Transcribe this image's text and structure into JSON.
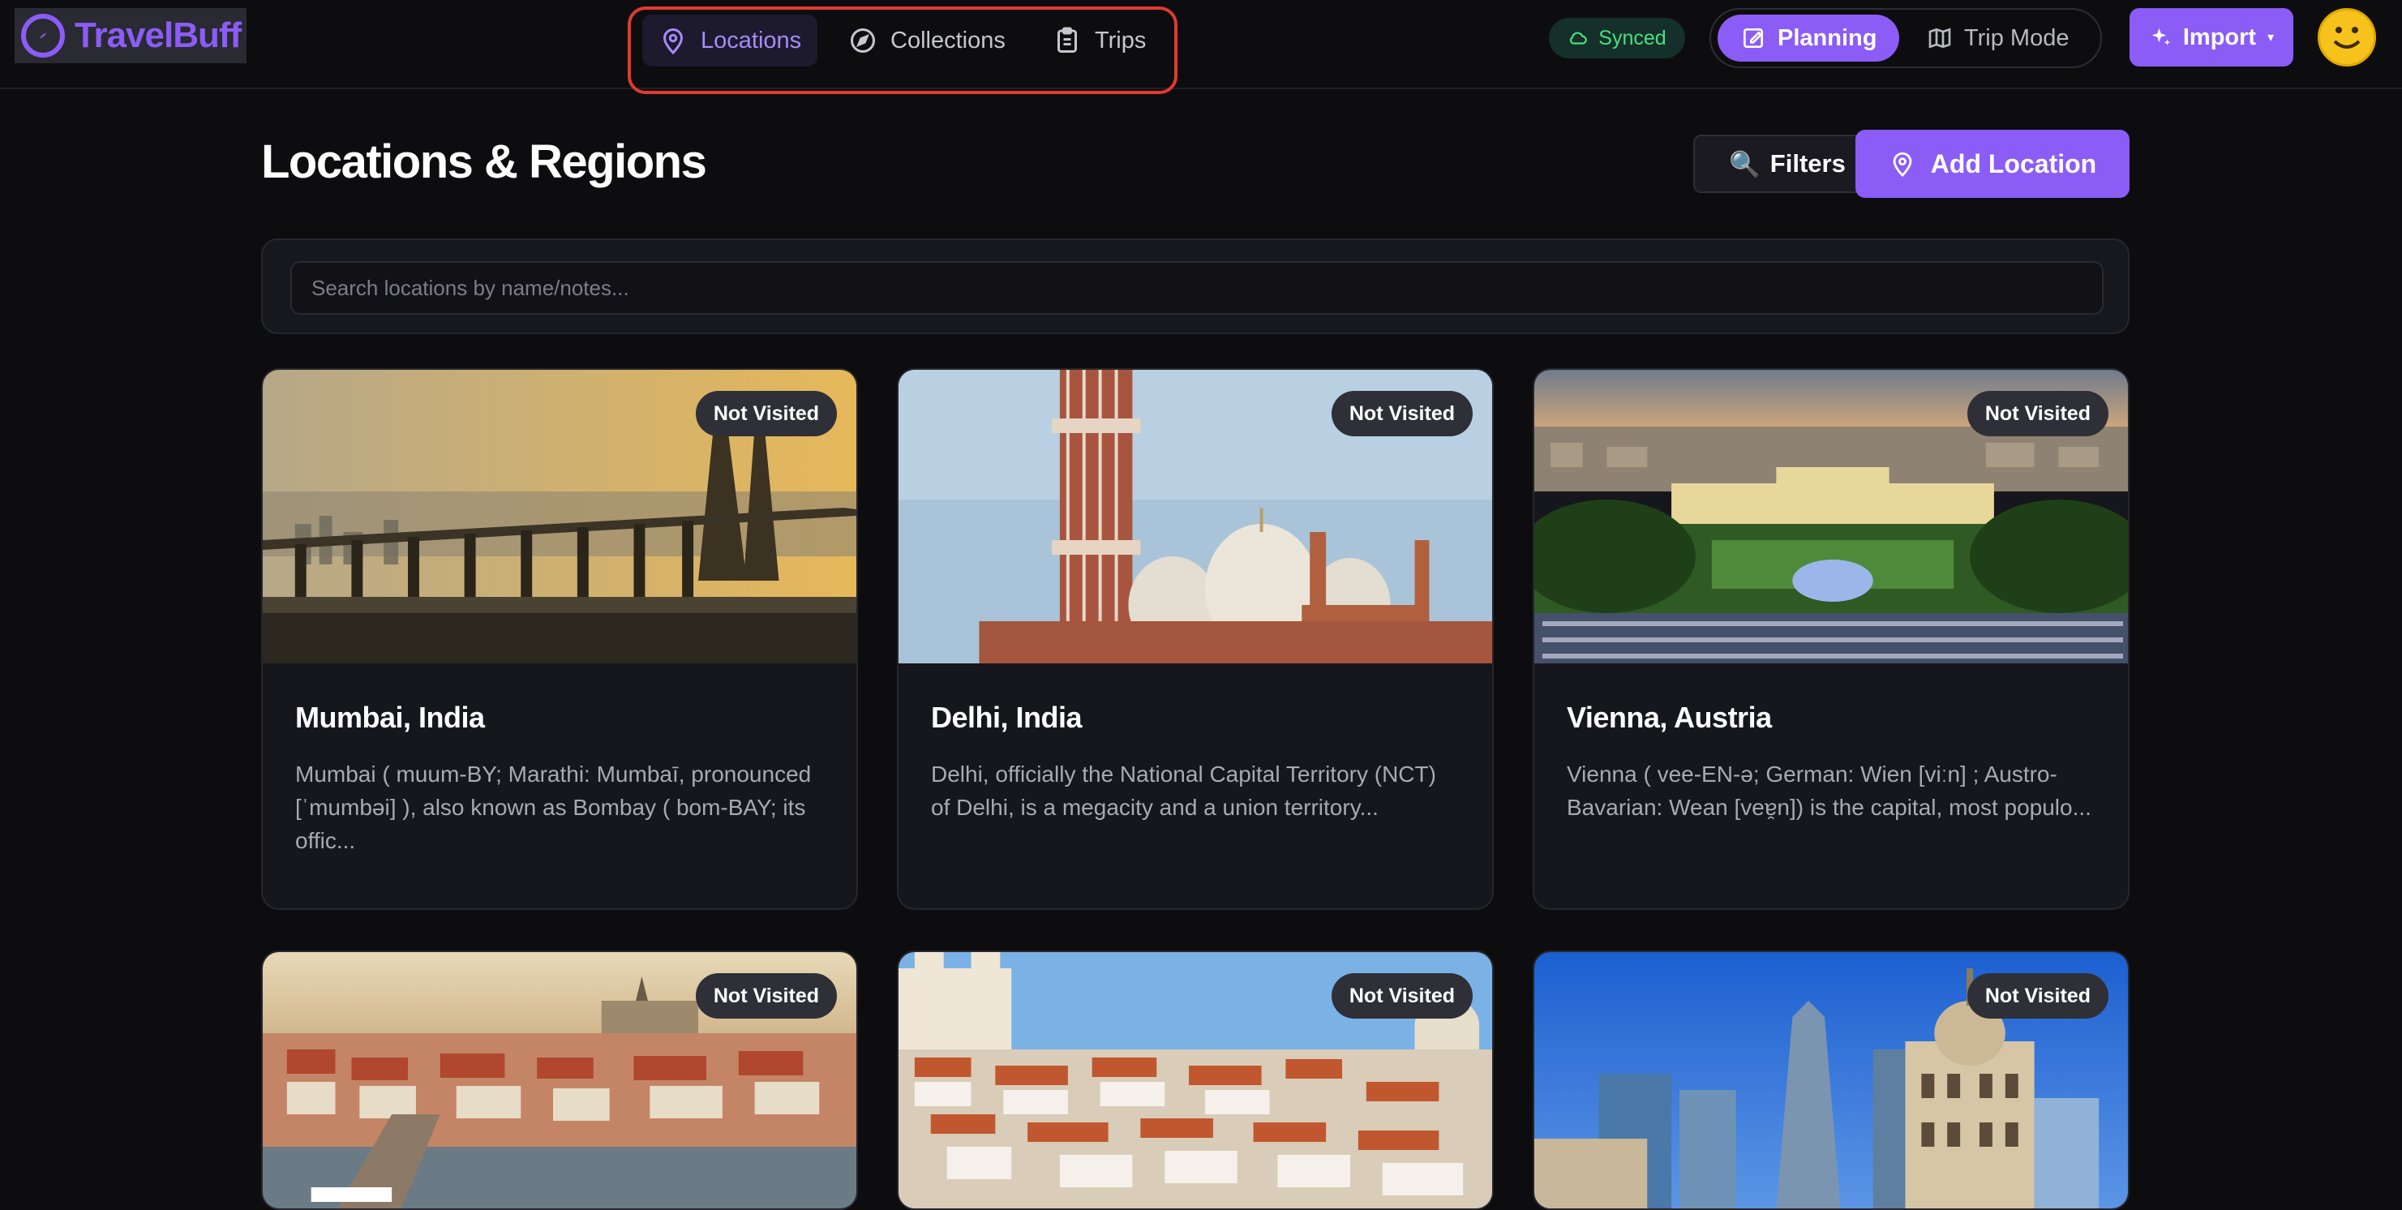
{
  "app": {
    "name": "TravelBuff"
  },
  "nav": {
    "items": [
      {
        "label": "Locations",
        "icon": "map-pin-icon",
        "active": true
      },
      {
        "label": "Collections",
        "icon": "compass-icon",
        "active": false
      },
      {
        "label": "Trips",
        "icon": "clipboard-icon",
        "active": false
      }
    ]
  },
  "status": {
    "sync_label": "Synced"
  },
  "mode": {
    "planning_label": "Planning",
    "trip_label": "Trip Mode",
    "active": "Planning"
  },
  "import": {
    "label": "Import"
  },
  "page": {
    "title": "Locations & Regions",
    "filters_label": "Filters",
    "add_label": "Add Location"
  },
  "search": {
    "placeholder": "Search locations by name/notes..."
  },
  "locations": [
    {
      "title": "Mumbai, India",
      "status": "Not Visited",
      "description": "Mumbai ( muum-BY; Marathi: Mumbaī, pronounced [ˈmumbəi] ), also known as Bombay ( bom-BAY; its offic..."
    },
    {
      "title": "Delhi, India",
      "status": "Not Visited",
      "description": "Delhi, officially the National Capital Territory (NCT) of Delhi, is a megacity and a union territory..."
    },
    {
      "title": "Vienna, Austria",
      "status": "Not Visited",
      "description": "Vienna ( vee-EN-ə; German: Wien [viːn] ; Austro-Bavarian: Wean [veɐ̯n]) is the capital, most populo..."
    },
    {
      "status": "Not Visited"
    },
    {
      "status": "Not Visited"
    },
    {
      "status": "Not Visited"
    }
  ],
  "colors": {
    "accent": "#8b5cf6",
    "background": "#0d0d10",
    "card": "#16161d",
    "sync_green": "#4ade80",
    "highlight_border": "#e23a2e"
  }
}
